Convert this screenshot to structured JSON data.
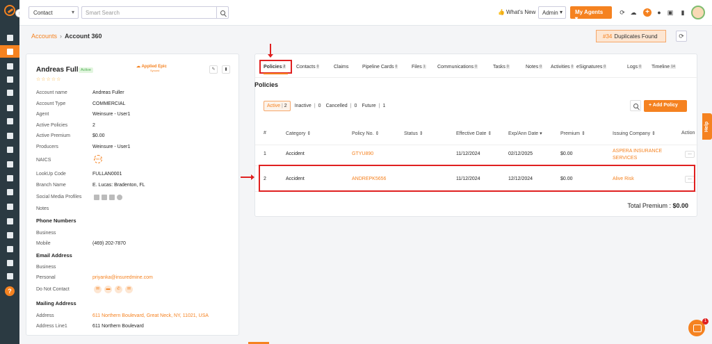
{
  "colors": {
    "accent": "#f58220",
    "highlight": "#e02020",
    "sidebar": "#2b3a42"
  },
  "topbar": {
    "contact_select": "Contact",
    "search_placeholder": "Smart Search",
    "whats_new": "What's New",
    "admin_select": "Admin",
    "my_agents": "My Agents"
  },
  "breadcrumb": {
    "parent": "Accounts",
    "current": "Account 360"
  },
  "duplicates": {
    "number": "#34",
    "label": "Duplicates Found"
  },
  "account": {
    "name": "Andreas Fuller",
    "status": "Active",
    "applied_epic": "Applied Epic",
    "applied_epic_sub": "Synced",
    "rows": [
      {
        "label": "Account name",
        "value": "Andreas Fuller"
      },
      {
        "label": "Account Type",
        "value": "COMMERCIAL"
      },
      {
        "label": "Agent",
        "value": "Weinsure - User1"
      },
      {
        "label": "Active Policies",
        "value": "2"
      },
      {
        "label": "Active Premium",
        "value": "$0.00"
      },
      {
        "label": "Producers",
        "value": "Weinsure - User1"
      },
      {
        "label": "NAICS",
        "value": ""
      },
      {
        "label": "LookUp Code",
        "value": "FULLAN0001"
      },
      {
        "label": "Branch Name",
        "value": "E. Lucas: Bradenton, FL"
      },
      {
        "label": "Social Media Profiles",
        "value": ""
      },
      {
        "label": "Notes",
        "value": ""
      }
    ],
    "naics_icon_text": "FACE",
    "phone_title": "Phone Numbers",
    "phone_rows": [
      {
        "label": "Business",
        "value": ""
      },
      {
        "label": "Mobile",
        "value": "(469) 202-7870"
      }
    ],
    "email_title": "Email Address",
    "email_rows": [
      {
        "label": "Business",
        "value": ""
      },
      {
        "label": "Personal",
        "value": "priyanka@insuredmine.com"
      }
    ],
    "dnc_label": "Do Not Contact",
    "mailing_title": "Mailing Address",
    "mailing_rows": [
      {
        "label": "Address",
        "value": "611 Northern Boulevard, Great Neck, NY, 11021, USA"
      },
      {
        "label": "Address Line1",
        "value": "611 Northern Boulevard"
      }
    ]
  },
  "tabs": [
    {
      "label": "Policies",
      "count": "2"
    },
    {
      "label": "Contacts",
      "count": "0"
    },
    {
      "label": "Claims",
      "count": ""
    },
    {
      "label": "Pipeline Cards",
      "count": "0"
    },
    {
      "label": "Files",
      "count": "1"
    },
    {
      "label": "Communications",
      "count": "0"
    },
    {
      "label": "Tasks",
      "count": "0"
    },
    {
      "label": "Notes",
      "count": "0"
    },
    {
      "label": "Activities",
      "count": "0"
    },
    {
      "label": "eSignatures",
      "count": "0"
    },
    {
      "label": "Logs",
      "count": "0"
    },
    {
      "label": "Timeline",
      "count": "14"
    }
  ],
  "policies": {
    "title": "Policies",
    "filters": {
      "active": "Active",
      "active_count": "2",
      "inactive": "Inactive",
      "inactive_count": "0",
      "cancelled": "Cancelled",
      "cancelled_count": "0",
      "future": "Future",
      "future_count": "1"
    },
    "add_button": "+ Add Policy",
    "columns": [
      "#",
      "Category ⇕",
      "Policy No. ⇕",
      "Status ⇕",
      "Effective Date ⇕",
      "Exp/Ann Date ▾",
      "Premium ⇕",
      "Issuing Company ⇕",
      "Action"
    ],
    "rows": [
      {
        "num": "1",
        "category": "Accident",
        "policy_no": "GTYU890",
        "status": "",
        "effective": "11/12/2024",
        "exp": "02/12/2025",
        "premium": "$0.00",
        "company": "ASPERA INSURANCE SERVICES"
      },
      {
        "num": "2",
        "category": "Accident",
        "policy_no": "ANDREPK5656",
        "status": "",
        "effective": "11/12/2024",
        "exp": "12/12/2024",
        "premium": "$0.00",
        "company": "Alive Risk"
      }
    ],
    "total_label": "Total Premium :",
    "total_value": "$0.00"
  },
  "help_tab": "Help",
  "chat_badge": "1"
}
